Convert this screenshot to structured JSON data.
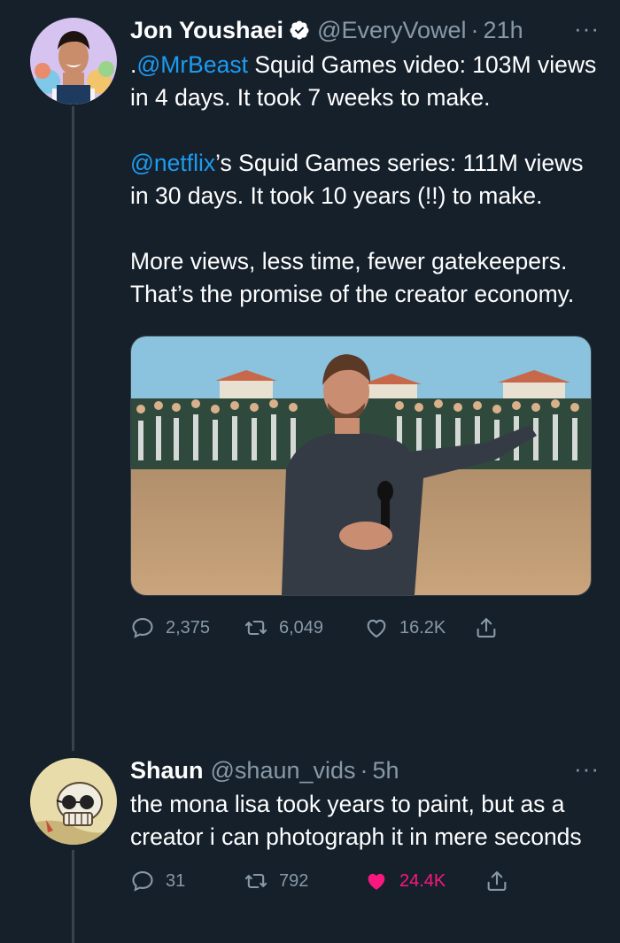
{
  "tweets": [
    {
      "name": "Jon Youshaei",
      "handle": "@EveryVowel",
      "dot": "·",
      "time": "21h",
      "more": "···",
      "p1_prefix": ".",
      "p1_mention": "@MrBeast",
      "p1_rest": " Squid Games video: 103M views in 4 days. It took 7 weeks to make.",
      "p2_mention": "@netflix",
      "p2_rest": "’s Squid Games series: 111M views in 30 days. It took 10 years (!!) to make.",
      "p3": "More views, less time, fewer gatekeepers. That’s the promise of the creator economy.",
      "replies": "2,375",
      "retweets": "6,049",
      "likes": "16.2K"
    },
    {
      "name": "Shaun",
      "handle": "@shaun_vids",
      "dot": "·",
      "time": "5h",
      "more": "···",
      "text": "the mona lisa took years to paint, but as a creator i can photograph it in mere seconds",
      "replies": "31",
      "retweets": "792",
      "likes": "24.4K"
    }
  ],
  "colors": {
    "background": "#15202b",
    "link": "#1d9bf0",
    "muted": "#8899a6",
    "like": "#f91880"
  },
  "icons": [
    "verified-badge-icon",
    "reply-icon",
    "retweet-icon",
    "like-icon",
    "share-icon",
    "more-icon"
  ]
}
